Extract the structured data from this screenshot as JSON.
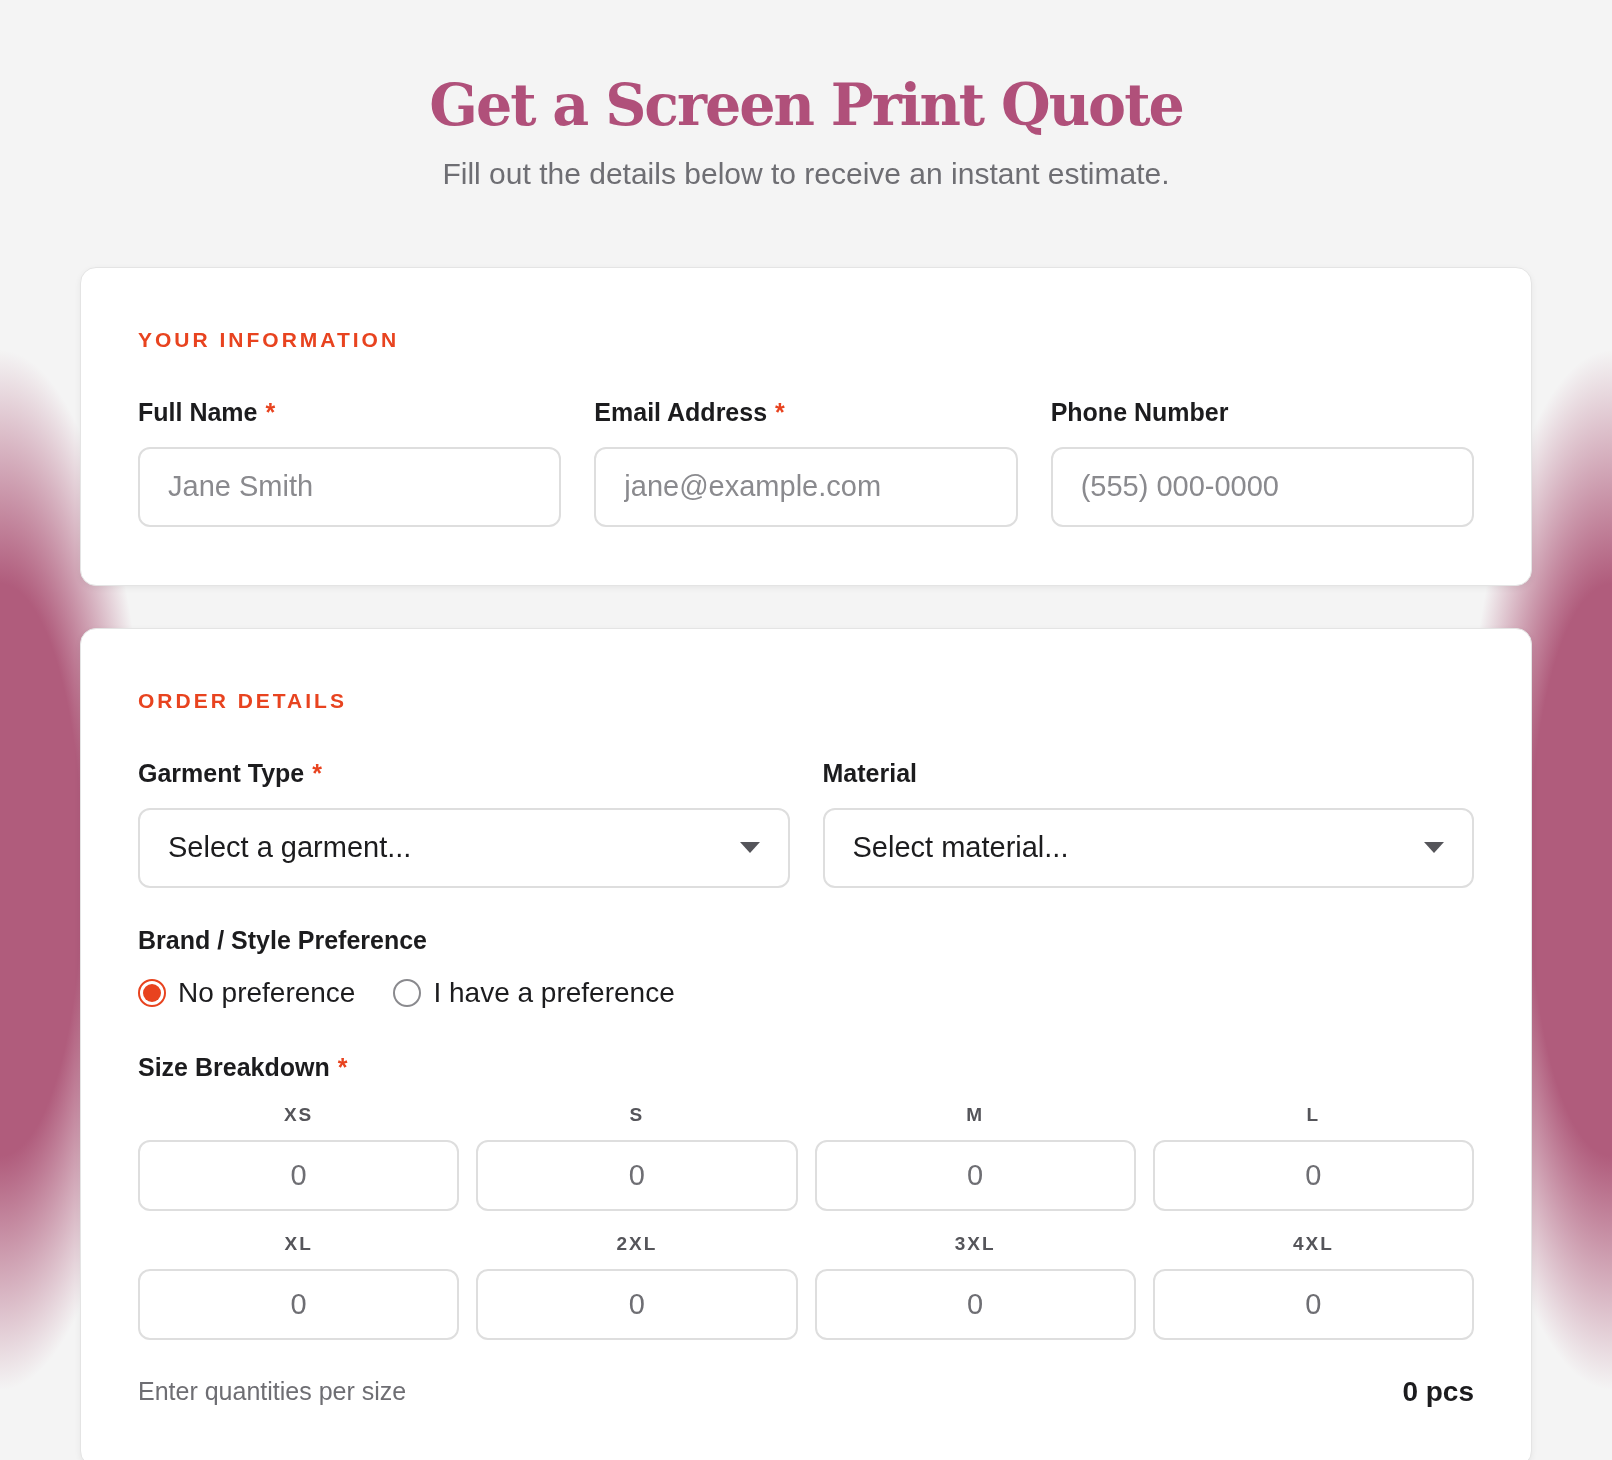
{
  "header": {
    "title": "Get a Screen Print Quote",
    "subtitle": "Fill out the details below to receive an instant estimate."
  },
  "info": {
    "heading": "YOUR INFORMATION",
    "fields": [
      {
        "label": "Full Name",
        "mark": "*",
        "placeholder": "Jane Smith"
      },
      {
        "label": "Email Address",
        "mark": "*",
        "placeholder": "jane@example.com"
      },
      {
        "label": "Phone Number",
        "placeholder": "(555) 000-0000"
      }
    ]
  },
  "order": {
    "heading": "ORDER DETAILS",
    "selects": [
      {
        "label": "Garment Type",
        "mark": "*",
        "value": "Select a garment..."
      },
      {
        "label": "Material",
        "value": "Select material..."
      }
    ],
    "brand": {
      "label": "Brand / Style Preference",
      "options": [
        {
          "label": "No preference",
          "selected": true
        },
        {
          "label": "I have a preference",
          "selected": false
        }
      ]
    },
    "sizes": {
      "label": "Size Breakdown",
      "mark": "*",
      "items": [
        {
          "size": "XS",
          "value": "0"
        },
        {
          "size": "S",
          "value": "0"
        },
        {
          "size": "M",
          "value": "0"
        },
        {
          "size": "L",
          "value": "0"
        },
        {
          "size": "XL",
          "value": "0"
        },
        {
          "size": "2XL",
          "value": "0"
        },
        {
          "size": "3XL",
          "value": "0"
        },
        {
          "size": "4XL",
          "value": "0"
        }
      ],
      "hint": "Enter quantities per size",
      "total": "0 pcs"
    }
  }
}
